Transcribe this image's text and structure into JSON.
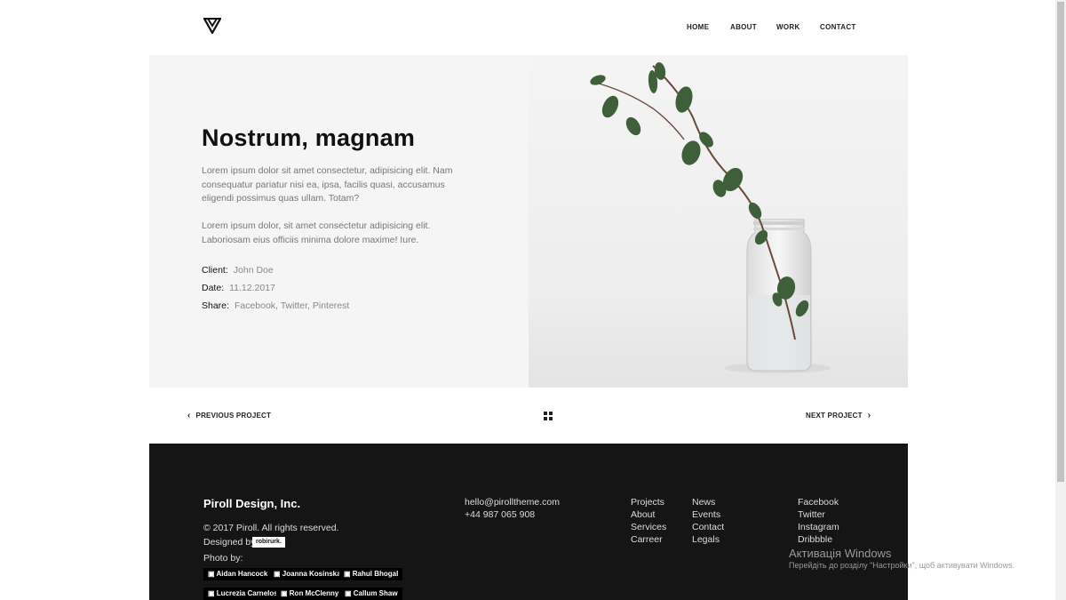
{
  "header": {
    "logo_icon": "triangle-logo-icon",
    "nav": [
      "HOME",
      "ABOUT",
      "WORK",
      "CONTACT"
    ]
  },
  "project": {
    "title": "Nostrum, magnam",
    "paragraph1": "Lorem ipsum dolor sit amet consectetur, adipisicing elit. Nam consequatur pariatur nisi ea, ipsa, facilis quasi, accusamus eligendi possimus quas ullam. Totam?",
    "paragraph2": "Lorem ipsum dolor, sit amet consectetur adipisicing elit. Laboriosam eius officiis minima dolore maxime! Iure.",
    "client_label": "Client:",
    "client_value": "John Doe",
    "date_label": "Date:",
    "date_value": "11.12.2017",
    "share_label": "Share:",
    "share_value": "Facebook, Twitter, Pinterest",
    "image_alt": "plant-in-glass-jar"
  },
  "pager": {
    "prev": "PREVIOUS PROJECT",
    "next": "NEXT PROJECT",
    "grid_icon": "grid-icon"
  },
  "footer": {
    "company": "Piroll Design, Inc.",
    "copyright": "© 2017 Piroll. All rights reserved.",
    "designed_by_label": "Designed by",
    "designer": "robirurk.",
    "photo_by_label": "Photo by:",
    "photographers": [
      "Aidan Hancock",
      "Joanna Kosinska",
      "Rahul Bhogal",
      "Lucrezia Carnelos",
      "Ron McClenny",
      "Callum Shaw"
    ],
    "email": "hello@pirolltheme.com",
    "phone": "+44 987 065 908",
    "col1": [
      "Projects",
      "About",
      "Services",
      "Carreer"
    ],
    "col2": [
      "News",
      "Events",
      "Contact",
      "Legals"
    ],
    "col3": [
      "Facebook",
      "Twitter",
      "Instagram",
      "Dribbble"
    ]
  },
  "windows_watermark": {
    "line1": "Активація Windows",
    "line2": "Перейдіть до розділу \"Настройки\", щоб активувати Windows."
  }
}
